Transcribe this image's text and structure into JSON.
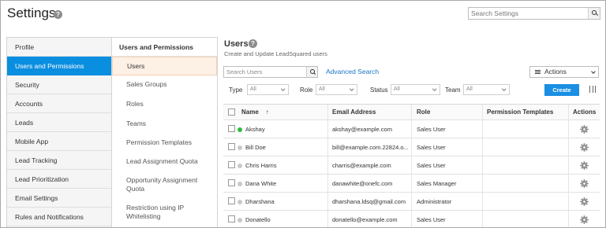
{
  "header": {
    "title": "Settings",
    "search_placeholder": "Search Settings"
  },
  "nav": {
    "items": [
      {
        "label": "Profile"
      },
      {
        "label": "Users and Permissions",
        "active": true
      },
      {
        "label": "Security"
      },
      {
        "label": "Accounts"
      },
      {
        "label": "Leads"
      },
      {
        "label": "Mobile App"
      },
      {
        "label": "Lead Tracking"
      },
      {
        "label": "Lead Prioritization"
      },
      {
        "label": "Email Settings"
      },
      {
        "label": "Rules and Notifications"
      }
    ]
  },
  "subnav": {
    "heading": "Users and Permissions",
    "items": [
      {
        "label": "Users",
        "active": true
      },
      {
        "label": "Sales Groups"
      },
      {
        "label": "Roles"
      },
      {
        "label": "Teams"
      },
      {
        "label": "Permission Templates"
      },
      {
        "label": "Lead Assignment Quota"
      },
      {
        "label": "Opportunity Assignment Quota"
      },
      {
        "label": "Restriction using IP Whitelisting"
      }
    ]
  },
  "main": {
    "title": "Users",
    "subtitle": "Create and Update LeadSquared users",
    "search_placeholder": "Search Users",
    "advanced_search": "Advanced Search",
    "actions_label": "Actions",
    "create_label": "Create",
    "filters": [
      {
        "label": "Type",
        "value": "All"
      },
      {
        "label": "Role",
        "value": "All"
      },
      {
        "label": "Status",
        "value": "All"
      },
      {
        "label": "Team",
        "value": "All"
      }
    ]
  },
  "table": {
    "columns": [
      "Name",
      "Email Address",
      "Role",
      "Permission Templates",
      "Actions"
    ],
    "sort_indicator": "↑",
    "rows": [
      {
        "name": "Akshay",
        "email": "akshay@example.com",
        "role": "Sales User",
        "online": true
      },
      {
        "name": "Bill Doe",
        "email": "bill@example.com.22824.o...",
        "role": "Sales User",
        "online": false
      },
      {
        "name": "Chris Harris",
        "email": "charris@example.com",
        "role": "Sales User",
        "online": false
      },
      {
        "name": "Dana White",
        "email": "danawhite@onefc.com",
        "role": "Sales Manager",
        "online": false
      },
      {
        "name": "Dharshana",
        "email": "dharshana.ldsq@gmail.com",
        "role": "Administrator",
        "online": false
      },
      {
        "name": "Donatello",
        "email": "donatello@example.com",
        "role": "Sales User",
        "online": false
      }
    ]
  },
  "colors": {
    "accent": "#0a8ee0",
    "create_button": "#1a8fe3",
    "link": "#1a73c9",
    "online_status": "#2ebd3b",
    "offline_status": "#c8c8c8",
    "active_subitem_bg": "#fdf0e5"
  },
  "icons": {
    "help": "question-circle-icon",
    "search": "magnifier-icon",
    "actions": "hamburger-icon",
    "dropdown": "chevron-down-icon",
    "columns": "columns-icon",
    "settings": "gear-icon",
    "sort": "sort-ascending-icon"
  }
}
